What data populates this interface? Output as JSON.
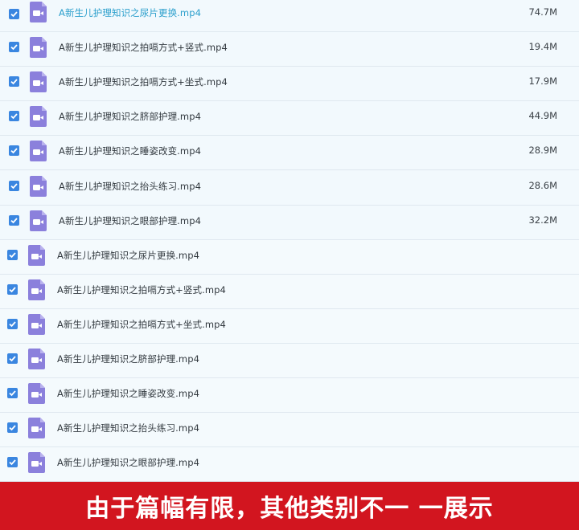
{
  "files": [
    {
      "name": "A新生儿护理知识之尿片更换.mp4",
      "size": "74.7M",
      "checked": true,
      "highlighted": true
    },
    {
      "name": "A新生儿护理知识之拍嗝方式+竖式.mp4",
      "size": "19.4M",
      "checked": true
    },
    {
      "name": "A新生儿护理知识之拍嗝方式+坐式.mp4",
      "size": "17.9M",
      "checked": true
    },
    {
      "name": "A新生儿护理知识之脐部护理.mp4",
      "size": "44.9M",
      "checked": true
    },
    {
      "name": "A新生儿护理知识之睡姿改变.mp4",
      "size": "28.9M",
      "checked": true
    },
    {
      "name": "A新生儿护理知识之抬头练习.mp4",
      "size": "28.6M",
      "checked": true
    },
    {
      "name": "A新生儿护理知识之眼部护理.mp4",
      "size": "32.2M",
      "checked": true
    },
    {
      "name": "A新生儿护理知识之尿片更换.mp4",
      "size": "",
      "checked": true
    },
    {
      "name": "A新生儿护理知识之拍嗝方式+竖式.mp4",
      "size": "",
      "checked": true
    },
    {
      "name": "A新生儿护理知识之拍嗝方式+坐式.mp4",
      "size": "",
      "checked": true
    },
    {
      "name": "A新生儿护理知识之脐部护理.mp4",
      "size": "",
      "checked": true
    },
    {
      "name": "A新生儿护理知识之睡姿改变.mp4",
      "size": "",
      "checked": true
    },
    {
      "name": "A新生儿护理知识之抬头练习.mp4",
      "size": "",
      "checked": true
    },
    {
      "name": "A新生儿护理知识之眼部护理.mp4",
      "size": "",
      "checked": true
    }
  ],
  "banner": {
    "text": "由于篇幅有限，其他类别不一 一展示"
  },
  "colors": {
    "checkbox": "#3a86e0",
    "video_icon": "#8b80dc",
    "link_text": "#2b9fcc",
    "banner": "#d2151f"
  },
  "icons": {
    "checkbox": "checkmark-icon",
    "file": "video-file-icon"
  }
}
